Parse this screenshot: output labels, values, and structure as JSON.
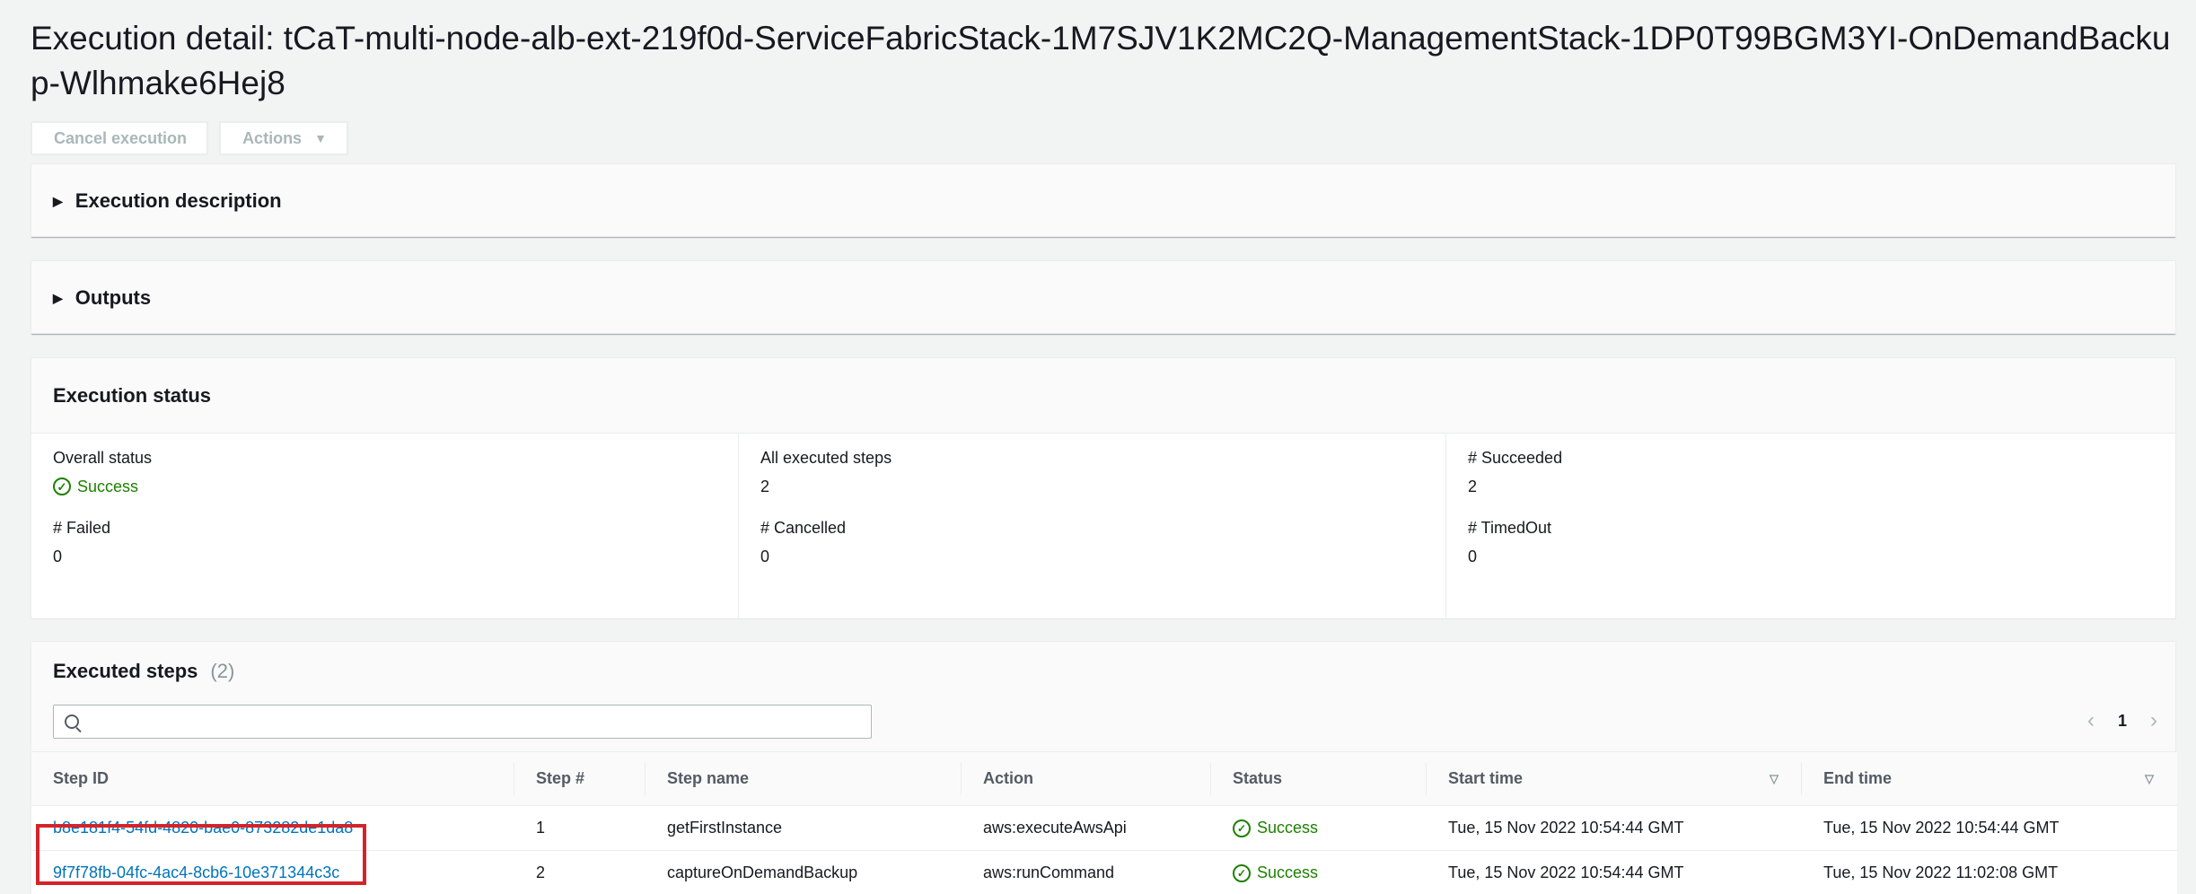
{
  "page": {
    "title": "Execution detail: tCaT-multi-node-alb-ext-219f0d-ServiceFabricStack-1M7SJV1K2MC2Q-ManagementStack-1DP0T99BGM3YI-OnDemandBackup-Wlhmake6Hej8"
  },
  "toolbar": {
    "cancel_label": "Cancel execution",
    "actions_label": "Actions"
  },
  "sections": {
    "description": "Execution description",
    "outputs": "Outputs"
  },
  "execution_status": {
    "title": "Execution status",
    "overall_status_label": "Overall status",
    "overall_status_value": "Success",
    "all_steps_label": "All executed steps",
    "all_steps_value": "2",
    "succeeded_label": "# Succeeded",
    "succeeded_value": "2",
    "failed_label": "# Failed",
    "failed_value": "0",
    "cancelled_label": "# Cancelled",
    "cancelled_value": "0",
    "timedout_label": "# TimedOut",
    "timedout_value": "0"
  },
  "executed_steps": {
    "title": "Executed steps",
    "count": "(2)",
    "search_placeholder": "",
    "page": "1",
    "columns": {
      "step_id": "Step ID",
      "step_num": "Step #",
      "step_name": "Step name",
      "action": "Action",
      "status": "Status",
      "start_time": "Start time",
      "end_time": "End time"
    },
    "rows": [
      {
        "step_id": "b8e181f4-54fd-4820-bae0-873282de1da8",
        "step_num": "1",
        "step_name": "getFirstInstance",
        "action": "aws:executeAwsApi",
        "status": "Success",
        "start_time": "Tue, 15 Nov 2022 10:54:44 GMT",
        "end_time": "Tue, 15 Nov 2022 10:54:44 GMT"
      },
      {
        "step_id": "9f7f78fb-04fc-4ac4-8cb6-10e371344c3c",
        "step_num": "2",
        "step_name": "captureOnDemandBackup",
        "action": "aws:runCommand",
        "status": "Success",
        "start_time": "Tue, 15 Nov 2022 10:54:44 GMT",
        "end_time": "Tue, 15 Nov 2022 11:02:08 GMT"
      }
    ]
  },
  "colors": {
    "success": "#1d8102",
    "link": "#0073bb",
    "highlight": "#d5232a"
  }
}
